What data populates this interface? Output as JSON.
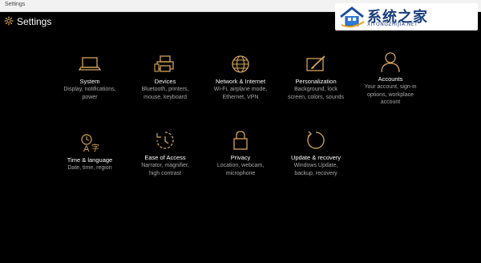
{
  "window": {
    "title": "Settings",
    "minimize_icon": "minimize-icon",
    "maximize_icon": "maximize-icon",
    "close_icon": "close-icon"
  },
  "header": {
    "title": "Settings",
    "icon": "gear-icon"
  },
  "watermark": {
    "text": "系统之家",
    "url": "XITONGZHIJIA.NET"
  },
  "accent_color": "#d4a35a",
  "tiles": [
    {
      "name": "System",
      "desc": [
        "Display, notifications,",
        "power"
      ],
      "icon": "laptop-icon"
    },
    {
      "name": "Devices",
      "desc": [
        "Bluetooth, printers,",
        "mouse, keyboard"
      ],
      "icon": "printer-icon"
    },
    {
      "name": "Network & Internet",
      "desc": [
        "Wi-Fi, airplane mode,",
        "Ethernet, VPN"
      ],
      "icon": "globe-icon"
    },
    {
      "name": "Personalization",
      "desc": [
        "Background, lock",
        "screen, colors, sounds"
      ],
      "icon": "paintbrush-icon"
    },
    {
      "name": "Accounts",
      "desc": [
        "Your account, sign-in",
        "options, workplace",
        "account"
      ],
      "icon": "person-icon"
    },
    {
      "name": "Time & language",
      "desc": [
        "Date, time, region"
      ],
      "icon": "time-language-icon"
    },
    {
      "name": "Ease of Access",
      "desc": [
        "Narrator, magnifier,",
        "high contrast"
      ],
      "icon": "ease-of-access-icon"
    },
    {
      "name": "Privacy",
      "desc": [
        "Location, webcam,",
        "microphone"
      ],
      "icon": "lock-icon"
    },
    {
      "name": "Update & recovery",
      "desc": [
        "Windows Update,",
        "backup, recovery"
      ],
      "icon": "refresh-icon"
    }
  ]
}
